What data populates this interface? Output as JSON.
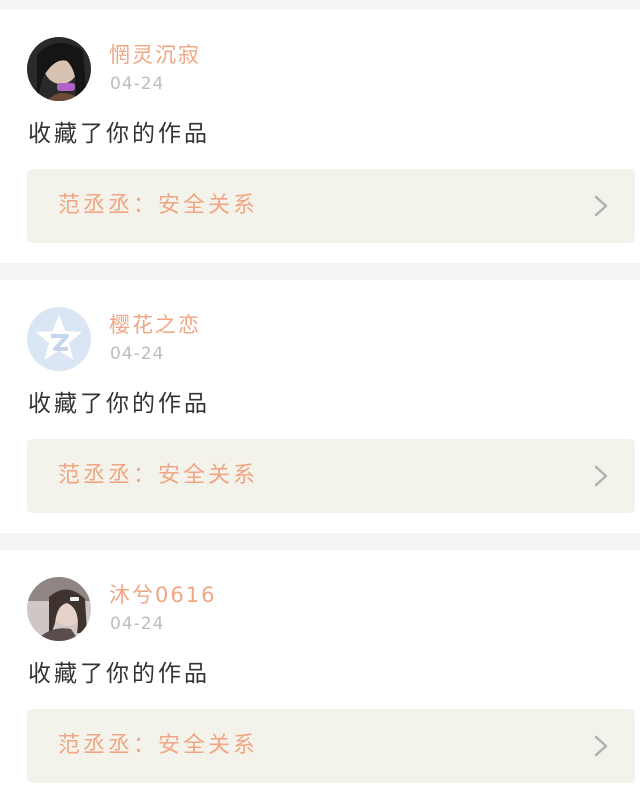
{
  "colors": {
    "page_background": "#f5f5f5",
    "card_background": "#ffffff",
    "username_color": "#f0a683",
    "date_color": "#bdbdbd",
    "action_color": "#333333",
    "work_box_background": "#f3f3ec",
    "work_text_color": "#f0a683",
    "chevron_color": "#b0b0b0"
  },
  "notifications": [
    {
      "avatar_icon": "user-avatar-photo",
      "username": "惘灵沉寂",
      "date": "04-24",
      "action": "收藏了你的作品",
      "work_label": "范丞丞：安全关系",
      "chevron_icon": "chevron-right-icon"
    },
    {
      "avatar_icon": "qzone-star-avatar",
      "username": "樱花之恋",
      "date": "04-24",
      "action": "收藏了你的作品",
      "work_label": "范丞丞：安全关系",
      "chevron_icon": "chevron-right-icon"
    },
    {
      "avatar_icon": "user-avatar-photo",
      "username": "沐兮0616",
      "date": "04-24",
      "action": "收藏了你的作品",
      "work_label": "范丞丞：安全关系",
      "chevron_icon": "chevron-right-icon"
    }
  ]
}
